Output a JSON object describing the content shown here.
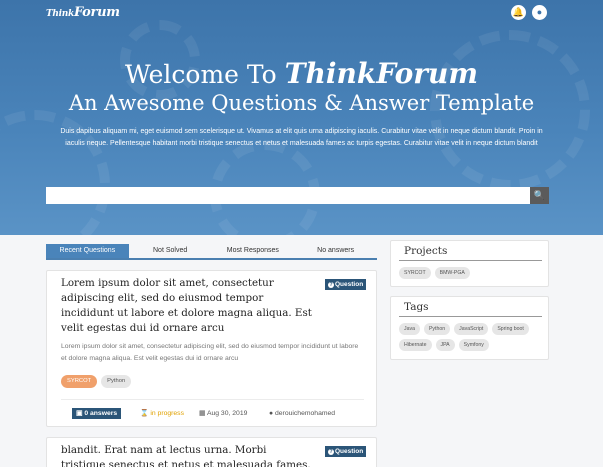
{
  "header": {
    "logo_main": "Think",
    "logo_brand": "Forum",
    "icons": [
      "bell-icon",
      "user-icon"
    ]
  },
  "hero": {
    "welcome_prefix": "Welcome To ",
    "welcome_brand": "ThinkForum",
    "subtitle": "An Awesome Questions & Answer Template",
    "description": "Duis dapibus aliquam mi, eget euismod sem scelerisque ut. Vivamus at elit quis urna adipiscing iaculis. Curabitur vitae velit in neque dictum blandit. Proin in iaculis neque. Pellentesque habitant morbi tristique senectus et netus et malesuada fames ac turpis egestas. Curabitur vitae velit in neque dictum blandit",
    "search_value": "",
    "search_placeholder": ""
  },
  "tabs": [
    "Recent Questions",
    "Not Solved",
    "Most Responses",
    "No answers"
  ],
  "questions": [
    {
      "title": "Lorem ipsum dolor sit amet, consectetur adipiscing elit, sed do eiusmod tempor incididunt ut labore et dolore magna aliqua. Est velit egestas dui id ornare arcu",
      "badge": "Question",
      "excerpt": "Lorem ipsum dolor sit amet, consectetur adipiscing elit, sed do eiusmod tempor incididunt ut labore et dolore magna aliqua. Est velit egestas dui id ornare arcu",
      "tags": [
        "SYRCOT",
        "Python"
      ],
      "answers": "0 answers",
      "status": "in progress",
      "date": "Aug 30, 2019",
      "author": "derouichemohamed"
    },
    {
      "title": "blandit. Erat nam at lectus urna. Morbi tristique senectus et netus et malesuada fames. Scelerisque",
      "badge": "Question"
    }
  ],
  "sidebar": {
    "projects": {
      "title": "Projects",
      "items": [
        "SYRCOT",
        "BMW-PGA"
      ]
    },
    "tags": {
      "title": "Tags",
      "items": [
        "Java",
        "Python",
        "JavaScript",
        "Spring boot",
        "Hibernate",
        "JPA",
        "Symfony"
      ]
    }
  },
  "colors": {
    "hero_blue": "#4a84ba",
    "badge_navy": "#2b5578",
    "tag_orange": "#f0a06b",
    "progress_gold": "#e0a100"
  }
}
